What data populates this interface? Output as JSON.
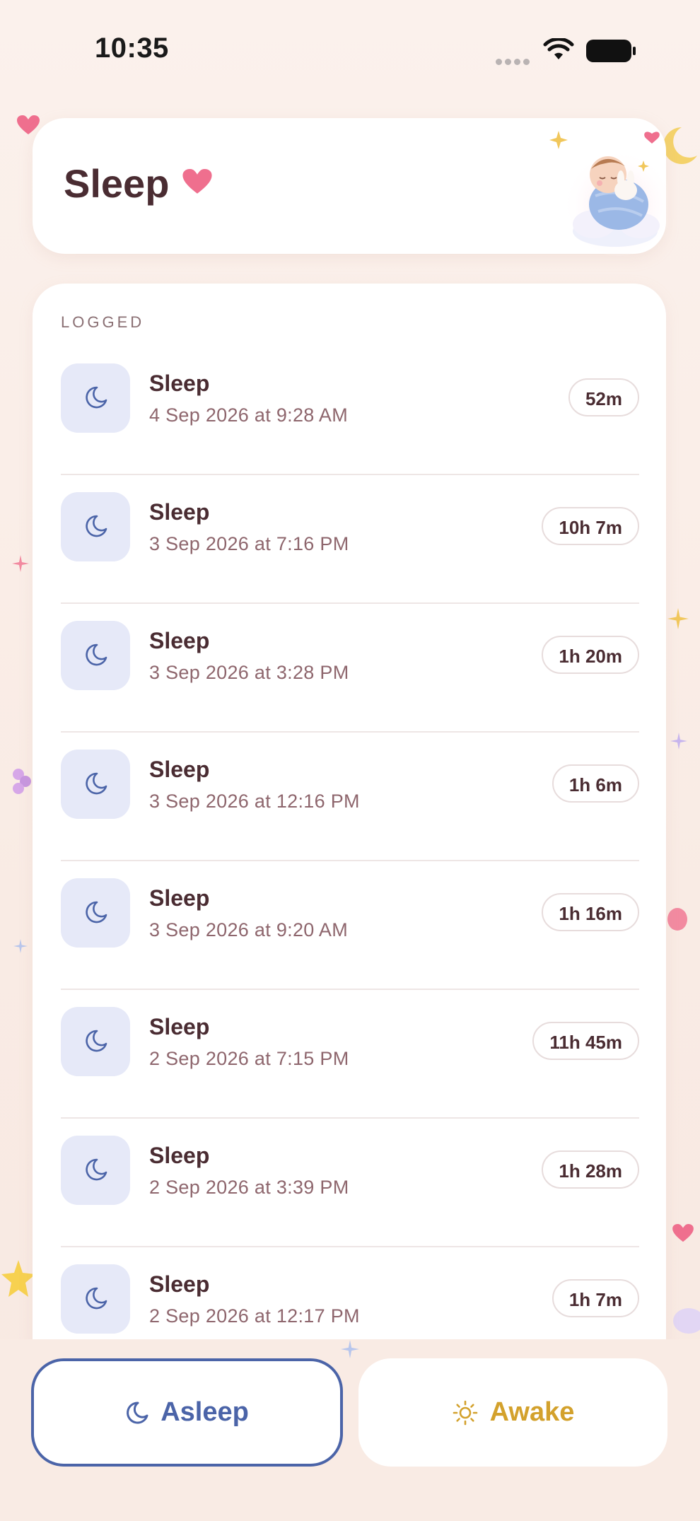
{
  "status_bar": {
    "time": "10:35"
  },
  "header": {
    "title": "Sleep"
  },
  "section_label": "LOGGED",
  "entries": [
    {
      "title": "Sleep",
      "date": "4 Sep 2026 at 9:28 AM",
      "duration": "52m"
    },
    {
      "title": "Sleep",
      "date": "3 Sep 2026 at 7:16 PM",
      "duration": "10h 7m"
    },
    {
      "title": "Sleep",
      "date": "3 Sep 2026 at 3:28 PM",
      "duration": "1h 20m"
    },
    {
      "title": "Sleep",
      "date": "3 Sep 2026 at 12:16 PM",
      "duration": "1h 6m"
    },
    {
      "title": "Sleep",
      "date": "3 Sep 2026 at 9:20 AM",
      "duration": "1h 16m"
    },
    {
      "title": "Sleep",
      "date": "2 Sep 2026 at 7:15 PM",
      "duration": "11h 45m"
    },
    {
      "title": "Sleep",
      "date": "2 Sep 2026 at 3:39 PM",
      "duration": "1h 28m"
    },
    {
      "title": "Sleep",
      "date": "2 Sep 2026 at 12:17 PM",
      "duration": "1h 7m"
    }
  ],
  "buttons": {
    "asleep": "Asleep",
    "awake": "Awake"
  },
  "colors": {
    "accent_blue": "#4b64a8",
    "accent_gold": "#d3a12c",
    "heart_pink": "#ef6f8e",
    "text_dark": "#4a2c32"
  },
  "icons": {
    "entry": "moon-icon",
    "asleep": "moon-icon",
    "awake": "sun-icon",
    "title": "heart-icon"
  }
}
